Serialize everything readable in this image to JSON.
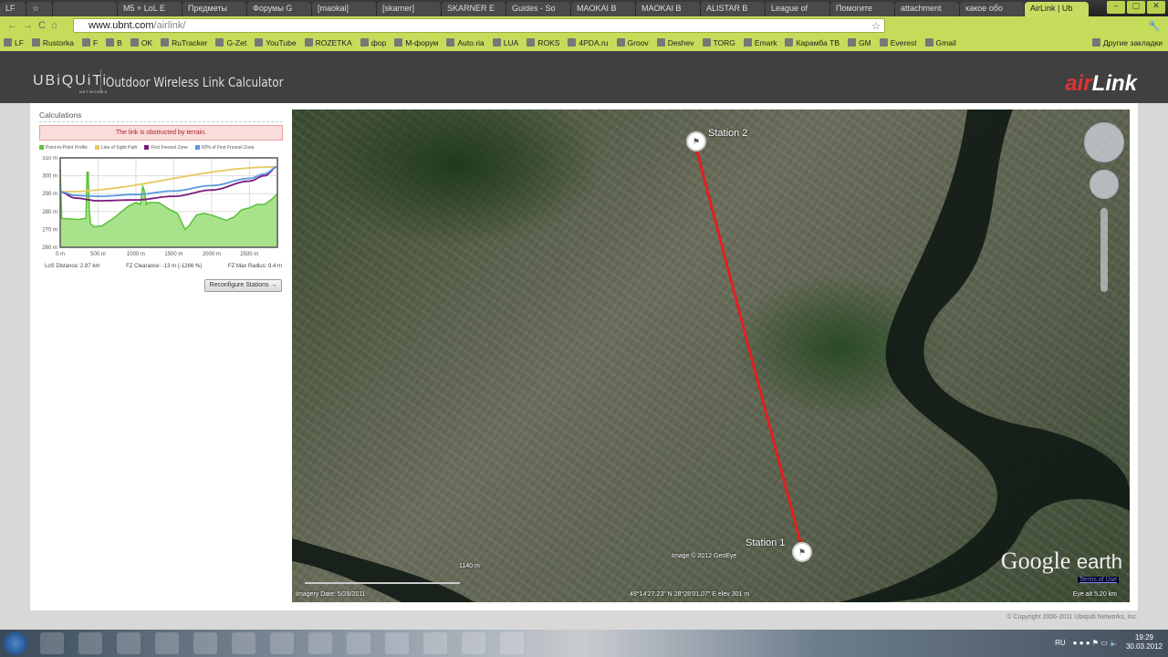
{
  "browser": {
    "tabs": [
      "LF",
      "☆",
      "",
      "M5 + LoL E",
      "Предметы",
      "Форумы G",
      "[maokai]",
      "[skarner]",
      "SKARNER E",
      "Guides - So",
      "MAOKAI B",
      "MAOKAI B",
      "ALISTAR B",
      "League of",
      "Помогите",
      "attachment",
      "какое обо",
      "AirLink | Ub"
    ],
    "active_tab": 17,
    "url_host": "www.ubnt.com",
    "url_path": "/airlink/",
    "bookmarks": [
      "LF",
      "Rustorka",
      "F",
      "B",
      "OK",
      "RuTracker",
      "G-Zet",
      "YouTube",
      "ROZETKA",
      "фор",
      "M-форум",
      "Auto.ria",
      "LUA",
      "ROKS",
      "4PDA.ru",
      "Groov",
      "Deshev",
      "TORG",
      "Emark",
      "Карамба ТВ",
      "GM",
      "Everest",
      "Gmail"
    ],
    "other_bookmarks": "Другие закладки"
  },
  "header": {
    "logo": "UBiQUiTi",
    "logo_sub": "NETWORKS",
    "title": "Outdoor Wireless Link Calculator",
    "brand_a": "air",
    "brand_b": "Link"
  },
  "calc": {
    "heading": "Calculations",
    "alert": "The link is obstructed by terrain.",
    "legend": [
      "Point-to-Point Profile",
      "Line of Sight Path",
      "First Fresnel Zone",
      "60% of First Fresnel Zone"
    ],
    "los_distance": "LoS Distance:  2.87 km",
    "fz_clearance": "FZ Clearance:  -13 m  (-1266 %)",
    "fz_radius": "FZ Max Radius:  9.4 m",
    "reconfigure": "Reconfigure Stations →"
  },
  "colors": {
    "profile": "#5cbf3a",
    "los": "#e8c860",
    "fresnel": "#7a1a7a",
    "fresnel60": "#5a9ae0"
  },
  "chart_data": {
    "type": "line",
    "xlim": [
      0,
      2870
    ],
    "ylim": [
      260,
      310
    ],
    "xticks": [
      0,
      500,
      1000,
      1500,
      2000,
      2500
    ],
    "xtick_labels": [
      "0 m",
      "500 m",
      "1000 m",
      "1500 m",
      "2000 m",
      "2500 m"
    ],
    "yticks": [
      260,
      270,
      280,
      290,
      300,
      310
    ],
    "ytick_labels": [
      "260 m",
      "270 m",
      "280 m",
      "290 m",
      "300 m",
      "310 m"
    ],
    "series": [
      {
        "name": "Point-to-Point Profile",
        "x": [
          0,
          10,
          20,
          100,
          250,
          300,
          340,
          355,
          370,
          385,
          400,
          450,
          550,
          700,
          900,
          1000,
          1060,
          1090,
          1110,
          1140,
          1170,
          1300,
          1450,
          1550,
          1650,
          1700,
          1800,
          1900,
          2000,
          2200,
          2300,
          2400,
          2500,
          2600,
          2700,
          2800,
          2870
        ],
        "y": [
          304,
          290,
          276,
          276,
          275.5,
          276,
          276,
          302,
          302,
          280,
          273,
          271.5,
          272,
          276,
          283,
          285,
          284,
          294,
          292,
          284,
          285,
          285,
          281,
          279,
          270,
          272,
          278,
          279,
          278,
          275,
          277,
          281,
          282,
          284,
          284,
          287,
          290
        ]
      },
      {
        "name": "Line of Sight Path",
        "x": [
          0,
          2870
        ],
        "y": [
          291,
          305
        ]
      },
      {
        "name": "First Fresnel Zone",
        "x": [
          0,
          200,
          500,
          1000,
          1500,
          2000,
          2500,
          2700,
          2870
        ],
        "y": [
          291,
          287.5,
          286,
          286.5,
          288.5,
          292,
          297,
          300,
          305
        ]
      },
      {
        "name": "60% of First Fresnel Zone",
        "x": [
          0,
          200,
          500,
          1000,
          1500,
          2000,
          2500,
          2700,
          2870
        ],
        "y": [
          291,
          289,
          288.5,
          289.5,
          291.5,
          294.5,
          298.5,
          301,
          305
        ]
      }
    ]
  },
  "map": {
    "station1": "Station 1",
    "station2": "Station 2",
    "scale": "1140 m",
    "imagery_date": "Imagery Date: 5/28/2011",
    "image_credit": "Image © 2012 GeoEye",
    "coords": "49°14'27.23\" N  28°28'01.07\" E  elev  301 m",
    "eye_alt": "Eye alt   5.20 km",
    "google": "Google",
    "earth": "earth",
    "terms": "Terms of Use"
  },
  "footer": {
    "copyright": "© Copyright 2006-2011 Ubiquiti Networks, Inc."
  },
  "taskbar": {
    "lang": "RU",
    "time": "19:29",
    "date": "30.03.2012"
  }
}
